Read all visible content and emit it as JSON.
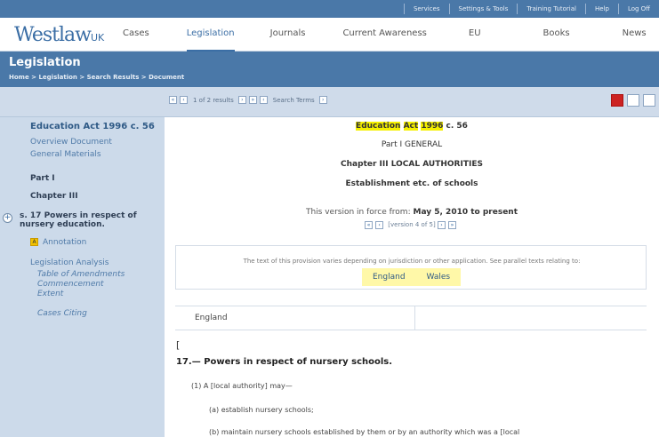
{
  "utility_bar": {
    "links": [
      "Services",
      "Settings & Tools",
      "Training Tutorial",
      "Help",
      "Log Off"
    ]
  },
  "header": {
    "logo_main": "Westlaw",
    "logo_suffix": "UK",
    "nav": [
      {
        "label": "Cases",
        "active": false
      },
      {
        "label": "Legislation",
        "active": true
      },
      {
        "label": "Journals",
        "active": false
      },
      {
        "label": "Current Awareness",
        "active": false
      },
      {
        "label": "EU",
        "active": false
      },
      {
        "label": "Books",
        "active": false
      },
      {
        "label": "News",
        "active": false
      }
    ]
  },
  "section": {
    "title": "Legislation",
    "breadcrumb": "Home > Legislation > Search Results > Document"
  },
  "toolbar": {
    "results_text": "1 of 2 results",
    "search_terms_label": "Search Terms"
  },
  "sidebar": {
    "title": "Education Act 1996 c. 56",
    "overview": "Overview Document",
    "general": "General Materials",
    "part": "Part I",
    "chapter": "Chapter III",
    "current": "s. 17 Powers in respect of nursery education.",
    "annotation": "Annotation",
    "analysis": "Legislation Analysis",
    "analysis_items": [
      "Table of Amendments",
      "Commencement",
      "Extent",
      "Cases Citing"
    ]
  },
  "document": {
    "title_hl1": "Education",
    "title_hl2": "Act",
    "title_hl3": "1996",
    "title_rest": " c. 56",
    "part": "Part I GENERAL",
    "chapter": "Chapter III LOCAL AUTHORITIES",
    "establishment": "Establishment etc. of schools",
    "version_prefix": "This version in force from: ",
    "version_date": "May 5, 2010 to present",
    "version_nav": "[version 4 of 5]",
    "notice": "The text of this provision varies depending on jurisdiction or other application. See parallel texts relating to:",
    "jurisdictions": [
      "England",
      "Wales"
    ],
    "tab_label": "England",
    "bracket": "[",
    "heading": "17.— Powers in respect of nursery schools.",
    "para1": "(1) A [local authority] may—",
    "para2": "(a) establish nursery schools;",
    "para3": "(b) maintain nursery schools established by them or by an authority which was a [local"
  }
}
